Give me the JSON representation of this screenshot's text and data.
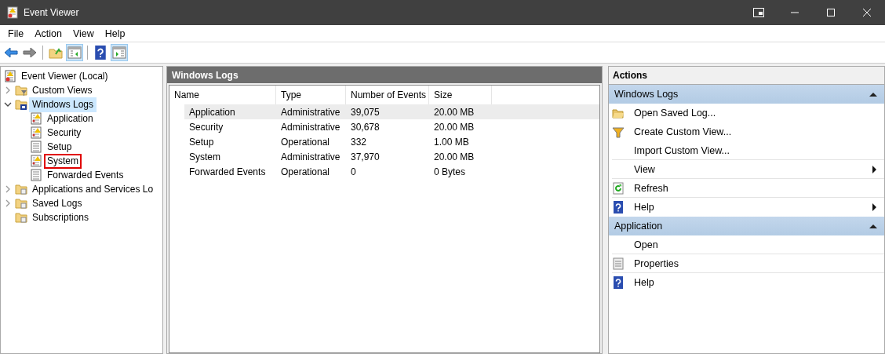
{
  "window": {
    "title": "Event Viewer"
  },
  "menu": [
    "File",
    "Action",
    "View",
    "Help"
  ],
  "toolbar": [
    {
      "kind": "back",
      "pressed": false
    },
    {
      "kind": "forward",
      "pressed": false
    },
    {
      "kind": "up",
      "pressed": false
    },
    {
      "kind": "tree",
      "pressed": true
    },
    {
      "kind": "help",
      "pressed": false
    },
    {
      "kind": "actionpane",
      "pressed": true
    }
  ],
  "tree": [
    {
      "label": "Event Viewer (Local)",
      "kind": "viewer",
      "selected": false,
      "highlighted": false,
      "children": [
        {
          "label": "Custom Views",
          "kind": "filterfolder",
          "expanded": false,
          "selected": false,
          "highlighted": false
        },
        {
          "label": "Windows Logs",
          "kind": "logfolder",
          "expanded": true,
          "selected": true,
          "highlighted": false,
          "children": [
            {
              "label": "Application",
              "kind": "warnlog",
              "selected": false,
              "highlighted": false
            },
            {
              "label": "Security",
              "kind": "warnlog",
              "selected": false,
              "highlighted": false
            },
            {
              "label": "Setup",
              "kind": "log",
              "selected": false,
              "highlighted": false
            },
            {
              "label": "System",
              "kind": "warnlog",
              "selected": false,
              "highlighted": true
            },
            {
              "label": "Forwarded Events",
              "kind": "log",
              "selected": false,
              "highlighted": false
            }
          ]
        },
        {
          "label": "Applications and Services Lo",
          "kind": "folder",
          "expanded": false,
          "selected": false,
          "highlighted": false
        },
        {
          "label": "Saved Logs",
          "kind": "folder",
          "expanded": false,
          "selected": false,
          "highlighted": false
        },
        {
          "label": "Subscriptions",
          "kind": "folder",
          "selected": false,
          "highlighted": false
        }
      ]
    }
  ],
  "middle": {
    "title": "Windows Logs",
    "columns": [
      "Name",
      "Type",
      "Number of Events",
      "Size"
    ],
    "rows": [
      {
        "cells": [
          "Application",
          "Administrative",
          "39,075",
          "20.00 MB"
        ],
        "selected": true
      },
      {
        "cells": [
          "Security",
          "Administrative",
          "30,678",
          "20.00 MB"
        ],
        "selected": false
      },
      {
        "cells": [
          "Setup",
          "Operational",
          "332",
          "1.00 MB"
        ],
        "selected": false
      },
      {
        "cells": [
          "System",
          "Administrative",
          "37,970",
          "20.00 MB"
        ],
        "selected": false
      },
      {
        "cells": [
          "Forwarded Events",
          "Operational",
          "0",
          "0 Bytes"
        ],
        "selected": false
      }
    ]
  },
  "actions": {
    "title": "Actions",
    "sections": [
      {
        "title": "Windows Logs",
        "expanded": true,
        "items": [
          {
            "label": "Open Saved Log...",
            "kind": "openfolder",
            "submenu": false,
            "divider": false
          },
          {
            "label": "Create Custom View...",
            "kind": "filter",
            "submenu": false,
            "divider": false
          },
          {
            "label": "Import Custom View...",
            "kind": "plain",
            "submenu": false,
            "divider": true
          },
          {
            "label": "View",
            "kind": "plain",
            "submenu": true,
            "divider": true
          },
          {
            "label": "Refresh",
            "kind": "refresh",
            "submenu": false,
            "divider": true
          },
          {
            "label": "Help",
            "kind": "help",
            "submenu": true,
            "divider": false
          }
        ]
      },
      {
        "title": "Application",
        "expanded": true,
        "items": [
          {
            "label": "Open",
            "kind": "plain",
            "submenu": false,
            "divider": true
          },
          {
            "label": "Properties",
            "kind": "properties",
            "submenu": false,
            "divider": true
          },
          {
            "label": "Help",
            "kind": "help",
            "submenu": false,
            "divider": false
          }
        ]
      }
    ]
  }
}
